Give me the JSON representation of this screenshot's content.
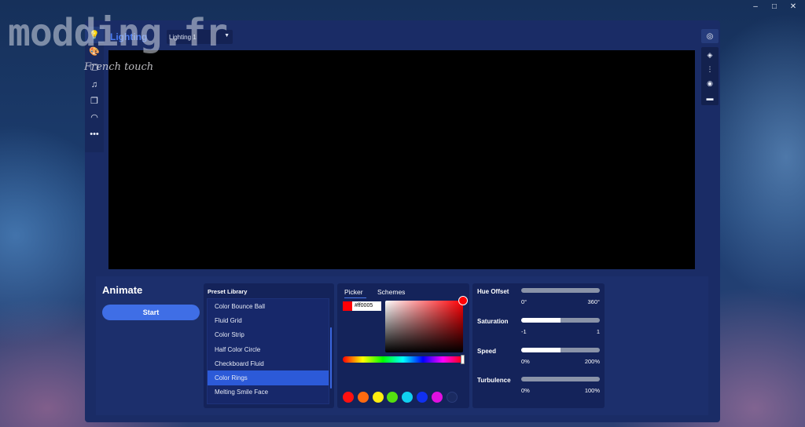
{
  "watermark": {
    "text": "modding.fr",
    "subtitle": "French touch"
  },
  "os_controls": {
    "minimize": "–",
    "maximize": "□",
    "close": "✕"
  },
  "header": {
    "title": "Lighting",
    "profile_select": "Lighting 1"
  },
  "sidebar": {
    "items": [
      {
        "icon": "lightbulb-icon",
        "glyph": "💡"
      },
      {
        "icon": "palette-icon",
        "glyph": "🎨"
      },
      {
        "icon": "monitor-icon",
        "glyph": "🖵"
      },
      {
        "icon": "music-icon",
        "glyph": "♫"
      },
      {
        "icon": "screens-icon",
        "glyph": "❐"
      },
      {
        "icon": "gauge-icon",
        "glyph": "◠"
      },
      {
        "icon": "more-icon",
        "glyph": "•••"
      }
    ]
  },
  "right_bar": {
    "top": {
      "icon": "spiral-icon",
      "glyph": "◎"
    },
    "items": [
      {
        "icon": "layers-icon",
        "glyph": "◈"
      },
      {
        "icon": "device-strip-icon",
        "glyph": "⋮"
      },
      {
        "icon": "device-logo-icon",
        "glyph": "◉"
      },
      {
        "icon": "keyboard-icon",
        "glyph": "▬"
      }
    ]
  },
  "animate": {
    "title": "Animate",
    "start_label": "Start"
  },
  "preset_library": {
    "title": "Preset Library",
    "items": [
      "Color Bounce Ball",
      "Fluid Grid",
      "Color Strip",
      "Half Color Circle",
      "Checkboard Fluid",
      "Color Rings",
      "Melting Smile Face"
    ],
    "selected_index": 5
  },
  "picker": {
    "tabs": [
      "Picker",
      "Schemes"
    ],
    "active_tab": "Picker",
    "hex_value": "#ff0005",
    "selected_color": "#ff0005",
    "hue_fraction": 1.0,
    "swatches": [
      "#ff1010",
      "#ff6a10",
      "#ffee10",
      "#55e010",
      "#10d0f0",
      "#1030f0",
      "#e010e0",
      "#1a2a60"
    ]
  },
  "params": [
    {
      "label": "Hue Offset",
      "min": "0°",
      "max": "360°",
      "fill": 0.0
    },
    {
      "label": "Saturation",
      "min": "-1",
      "max": "1",
      "fill": 0.5
    },
    {
      "label": "Speed",
      "min": "0%",
      "max": "200%",
      "fill": 0.5
    },
    {
      "label": "Turbulence",
      "min": "0%",
      "max": "100%",
      "fill": 0.0
    }
  ],
  "colors": {
    "accent": "#3f6ee6",
    "canvas": "#000000",
    "panel": "#14235a"
  }
}
